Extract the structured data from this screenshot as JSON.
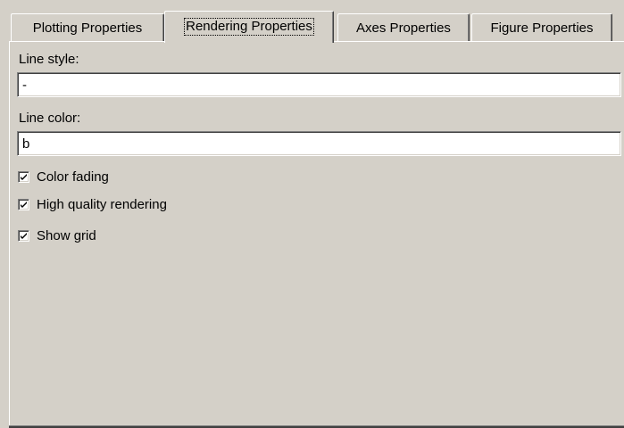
{
  "tabs": [
    {
      "label": "Plotting Properties",
      "active": false
    },
    {
      "label": "Rendering Properties",
      "active": true
    },
    {
      "label": "Axes Properties",
      "active": false
    },
    {
      "label": "Figure Properties",
      "active": false
    }
  ],
  "form": {
    "line_style": {
      "label": "Line style:",
      "value": "-"
    },
    "line_color": {
      "label": "Line color:",
      "value": "b"
    }
  },
  "checkboxes": [
    {
      "label": "Color fading",
      "checked": true
    },
    {
      "label": "High quality rendering",
      "checked": true
    },
    {
      "label": "Show grid",
      "checked": true
    }
  ],
  "colors": {
    "face": "#d4d0c8",
    "highlight": "#ffffff",
    "shadow": "#808080",
    "dark_shadow": "#404040"
  }
}
